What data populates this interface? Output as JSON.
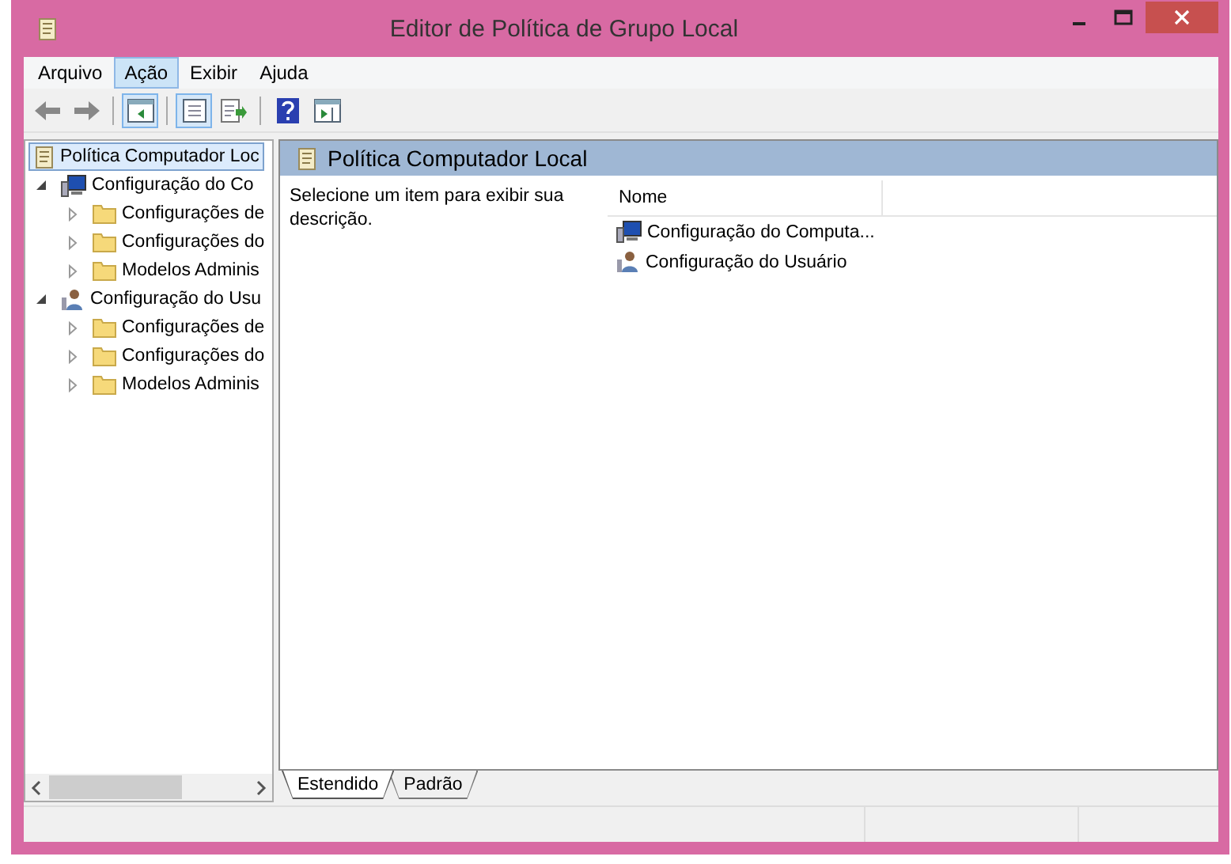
{
  "window": {
    "title": "Editor de Política de Grupo Local"
  },
  "menu": [
    {
      "label": "Arquivo",
      "selected": false
    },
    {
      "label": "Ação",
      "selected": true
    },
    {
      "label": "Exibir",
      "selected": false
    },
    {
      "label": "Ajuda",
      "selected": false
    }
  ],
  "toolbar": [
    {
      "kind": "back",
      "pressed": false
    },
    {
      "kind": "forward",
      "pressed": false
    },
    {
      "kind": "sep"
    },
    {
      "kind": "tree",
      "pressed": true
    },
    {
      "kind": "sep"
    },
    {
      "kind": "properties",
      "pressed": true
    },
    {
      "kind": "export",
      "pressed": false
    },
    {
      "kind": "sep"
    },
    {
      "kind": "help",
      "pressed": false
    },
    {
      "kind": "actionpane",
      "pressed": false
    }
  ],
  "tree": [
    {
      "label": "Política Computador Loc",
      "kind": "policy",
      "selected": true,
      "children": [
        {
          "label": "Configuração do Co",
          "kind": "computer",
          "expanded": true,
          "selected": false,
          "children": [
            {
              "label": "Configurações de",
              "kind": "folder",
              "expanded": false,
              "selected": false
            },
            {
              "label": "Configurações do",
              "kind": "folder",
              "expanded": false,
              "selected": false
            },
            {
              "label": "Modelos Adminis",
              "kind": "folder",
              "expanded": false,
              "selected": false
            }
          ]
        },
        {
          "label": "Configuração do Usu",
          "kind": "user",
          "expanded": true,
          "selected": false,
          "children": [
            {
              "label": "Configurações de",
              "kind": "folder",
              "expanded": false,
              "selected": false
            },
            {
              "label": "Configurações do",
              "kind": "folder",
              "expanded": false,
              "selected": false
            },
            {
              "label": "Modelos Adminis",
              "kind": "folder",
              "expanded": false,
              "selected": false
            }
          ]
        }
      ]
    }
  ],
  "details": {
    "title": "Política Computador Local",
    "description": "Selecione um item para exibir sua descrição.",
    "columns": [
      "Nome"
    ],
    "rows": [
      {
        "name": "Configuração do Computa...",
        "kind": "computer"
      },
      {
        "name": "Configuração do Usuário",
        "kind": "user"
      }
    ]
  },
  "tabs": [
    {
      "label": "Estendido",
      "selected": true
    },
    {
      "label": "Padrão",
      "selected": false
    }
  ]
}
